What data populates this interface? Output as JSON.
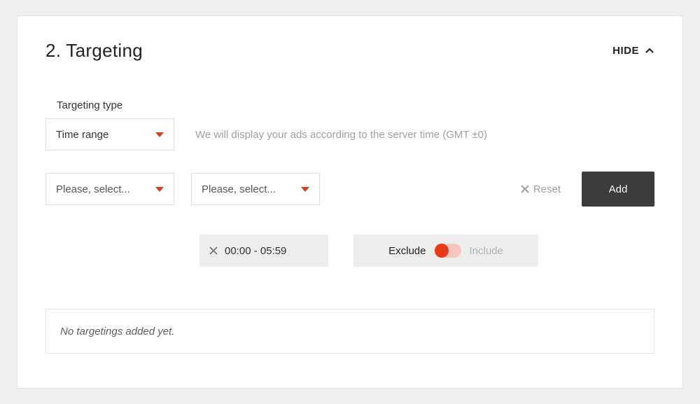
{
  "panel": {
    "title": "2. Targeting",
    "hide_label": "HIDE"
  },
  "targeting_type": {
    "label": "Targeting type",
    "selected": "Time range",
    "hint": "We will display your ads according to the server time (GMT ±0)"
  },
  "selects": {
    "from_placeholder": "Please, select...",
    "to_placeholder": "Please, select..."
  },
  "actions": {
    "reset": "Reset",
    "add": "Add"
  },
  "chip": {
    "range": "00:00 - 05:59"
  },
  "toggle": {
    "exclude": "Exclude",
    "include": "Include",
    "state": "exclude"
  },
  "empty_state": "No targetings added yet."
}
